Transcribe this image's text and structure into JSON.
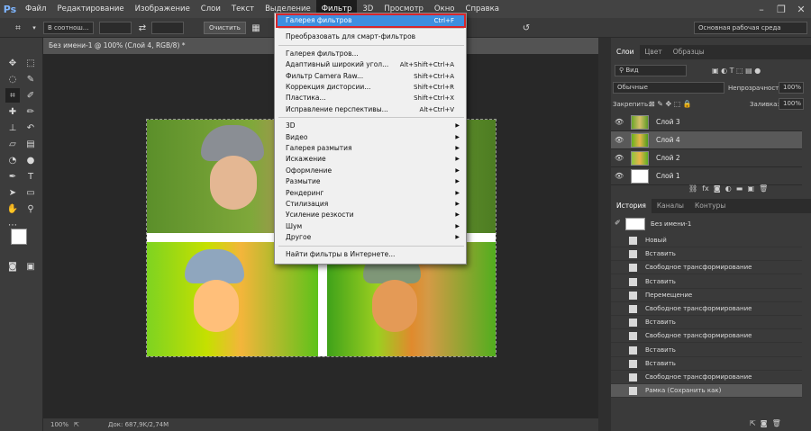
{
  "menu": {
    "items": [
      "Файл",
      "Редактирование",
      "Изображение",
      "Слои",
      "Текст",
      "Выделение",
      "Фильтр",
      "3D",
      "Просмотр",
      "Окно",
      "Справка"
    ],
    "active": "Фильтр",
    "logo": "Ps"
  },
  "options": {
    "ratio": "В соотнош...",
    "clear_label": "Очистить",
    "workspace": "Основная рабочая среда"
  },
  "document": {
    "tab_title": "Без имени-1 @ 100% (Слой 4, RGB/8) *",
    "zoom": "100%",
    "doc_info": "Док: 687,9K/2,74M"
  },
  "filter_menu": {
    "items": [
      {
        "label": "Галерея фильтров",
        "shortcut": "Ctrl+F",
        "highlighted": true
      },
      {
        "sep": true
      },
      {
        "label": "Преобразовать для смарт-фильтров"
      },
      {
        "sep": true
      },
      {
        "label": "Галерея фильтров..."
      },
      {
        "label": "Адаптивный широкий угол...",
        "shortcut": "Alt+Shift+Ctrl+A"
      },
      {
        "label": "Фильтр Camera Raw...",
        "shortcut": "Shift+Ctrl+A"
      },
      {
        "label": "Коррекция дисторсии...",
        "shortcut": "Shift+Ctrl+R"
      },
      {
        "label": "Пластика...",
        "shortcut": "Shift+Ctrl+X"
      },
      {
        "label": "Исправление перспективы...",
        "shortcut": "Alt+Ctrl+V"
      },
      {
        "sep": true
      },
      {
        "label": "3D",
        "submenu": true
      },
      {
        "label": "Видео",
        "submenu": true
      },
      {
        "label": "Галерея размытия",
        "submenu": true
      },
      {
        "label": "Искажение",
        "submenu": true
      },
      {
        "label": "Оформление",
        "submenu": true
      },
      {
        "label": "Размытие",
        "submenu": true
      },
      {
        "label": "Рендеринг",
        "submenu": true
      },
      {
        "label": "Стилизация",
        "submenu": true
      },
      {
        "label": "Усиление резкости",
        "submenu": true
      },
      {
        "label": "Шум",
        "submenu": true
      },
      {
        "label": "Другое",
        "submenu": true
      },
      {
        "sep": true
      },
      {
        "label": "Найти фильтры в Интернете..."
      }
    ]
  },
  "layers_panel": {
    "tabs": [
      "Слои",
      "Цвет",
      "Образцы"
    ],
    "kind_filter": "Вид",
    "blend_mode": "Обычные",
    "opacity_label": "Непрозрачность:",
    "opacity_value": "100%",
    "lock_label": "Закрепить:",
    "fill_label": "Заливка:",
    "fill_value": "100%",
    "layers": [
      {
        "name": "Слой 3",
        "selected": false
      },
      {
        "name": "Слой 4",
        "selected": true
      },
      {
        "name": "Слой 2",
        "selected": false
      },
      {
        "name": "Слой 1",
        "selected": false
      }
    ]
  },
  "history_panel": {
    "tabs": [
      "История",
      "Каналы",
      "Контуры"
    ],
    "snapshot": "Без имени-1",
    "steps": [
      {
        "name": "Новый",
        "selected": false
      },
      {
        "name": "Вставить",
        "selected": false
      },
      {
        "name": "Свободное трансформирование",
        "selected": false
      },
      {
        "name": "Вставить",
        "selected": false
      },
      {
        "name": "Перемещение",
        "selected": false
      },
      {
        "name": "Свободное трансформирование",
        "selected": false
      },
      {
        "name": "Вставить",
        "selected": false
      },
      {
        "name": "Свободное трансформирование",
        "selected": false
      },
      {
        "name": "Вставить",
        "selected": false
      },
      {
        "name": "Вставить",
        "selected": false
      },
      {
        "name": "Свободное трансформирование",
        "selected": false
      },
      {
        "name": "Рамка (Сохранить как)",
        "selected": true
      }
    ]
  },
  "colors": {
    "highlight": "#3d8fe0",
    "callout_frame": "#d8262b",
    "app_bg": "#535353"
  }
}
